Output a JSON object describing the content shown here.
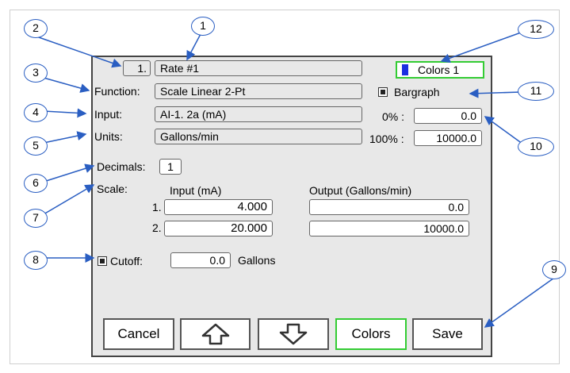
{
  "header": {
    "index": "1.",
    "name": "Rate #1",
    "colors_label": "Colors 1"
  },
  "function": {
    "label": "Function:",
    "value": "Scale Linear 2-Pt"
  },
  "input": {
    "label": "Input:",
    "value": "AI-1. 2a (mA)"
  },
  "units": {
    "label": "Units:",
    "value": "Gallons/min"
  },
  "decimals": {
    "label": "Decimals:",
    "value": "1"
  },
  "bargraph": {
    "label": "Bargraph",
    "checked": true,
    "zero_label": "0% :",
    "zero_value": "0.0",
    "full_label": "100% :",
    "full_value": "10000.0"
  },
  "scale": {
    "label": "Scale:",
    "input_header": "Input (mA)",
    "output_header": "Output (Gallons/min)",
    "rows": [
      {
        "num": "1.",
        "input": "4.000",
        "output": "0.0"
      },
      {
        "num": "2.",
        "input": "20.000",
        "output": "10000.0"
      }
    ]
  },
  "cutoff": {
    "label": "Cutoff:",
    "checked": true,
    "value": "0.0",
    "unit": "Gallons"
  },
  "buttons": {
    "cancel": "Cancel",
    "up": "up-arrow-icon",
    "down": "down-arrow-icon",
    "colors": "Colors",
    "save": "Save"
  },
  "callouts": [
    "1",
    "2",
    "3",
    "4",
    "5",
    "6",
    "7",
    "8",
    "9",
    "10",
    "11",
    "12"
  ],
  "colors": {
    "callout_border": "#2a5ec2",
    "highlight_border": "#33cc33",
    "swatch": "#1b2fe0",
    "panel_bg": "#e8e8e8"
  }
}
